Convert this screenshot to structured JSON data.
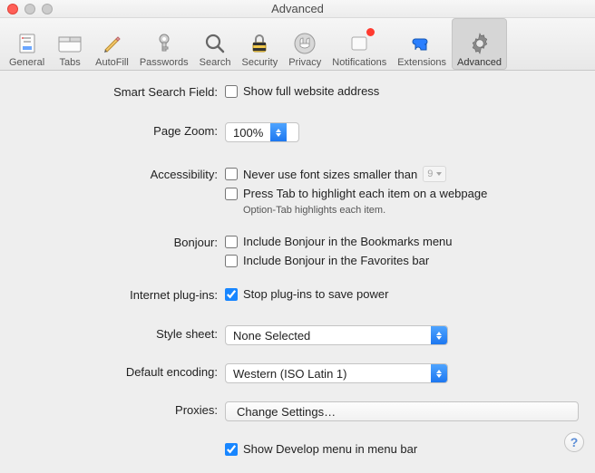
{
  "window": {
    "title": "Advanced"
  },
  "toolbar": {
    "items": [
      {
        "label": "General"
      },
      {
        "label": "Tabs"
      },
      {
        "label": "AutoFill"
      },
      {
        "label": "Passwords"
      },
      {
        "label": "Search"
      },
      {
        "label": "Security"
      },
      {
        "label": "Privacy"
      },
      {
        "label": "Notifications"
      },
      {
        "label": "Extensions"
      },
      {
        "label": "Advanced"
      }
    ]
  },
  "labels": {
    "smart_search": "Smart Search Field:",
    "page_zoom": "Page Zoom:",
    "accessibility": "Accessibility:",
    "bonjour": "Bonjour:",
    "plugins": "Internet plug-ins:",
    "style_sheet": "Style sheet:",
    "default_encoding": "Default encoding:",
    "proxies": "Proxies:"
  },
  "values": {
    "show_full_address": "Show full website address",
    "zoom": "100%",
    "never_font_smaller": "Never use font sizes smaller than",
    "min_font": "9",
    "press_tab": "Press Tab to highlight each item on a webpage",
    "option_tab_note": "Option-Tab highlights each item.",
    "bonjour_bookmarks": "Include Bonjour in the Bookmarks menu",
    "bonjour_favorites": "Include Bonjour in the Favorites bar",
    "stop_plugins": "Stop plug-ins to save power",
    "style_sheet": "None Selected",
    "encoding": "Western (ISO Latin 1)",
    "change_settings": "Change Settings…",
    "develop_menu": "Show Develop menu in menu bar"
  },
  "help": "?"
}
